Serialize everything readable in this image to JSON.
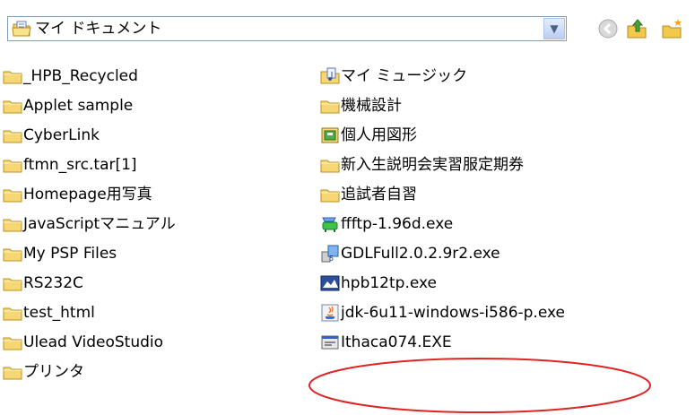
{
  "address": {
    "location": "マイ ドキュメント"
  },
  "items": [
    {
      "label": "_HPB_Recycled",
      "icon": "folder-icon"
    },
    {
      "label": "Applet sample",
      "icon": "folder-icon"
    },
    {
      "label": "CyberLink",
      "icon": "folder-icon"
    },
    {
      "label": "ftmn_src.tar[1]",
      "icon": "folder-icon"
    },
    {
      "label": "Homepage用写真",
      "icon": "folder-icon"
    },
    {
      "label": "JavaScriptマニュアル",
      "icon": "folder-icon"
    },
    {
      "label": "My PSP Files",
      "icon": "folder-icon"
    },
    {
      "label": "RS232C",
      "icon": "folder-icon"
    },
    {
      "label": "test_html",
      "icon": "folder-icon"
    },
    {
      "label": "Ulead VideoStudio",
      "icon": "folder-icon"
    },
    {
      "label": "プリンタ",
      "icon": "folder-icon"
    },
    {
      "label": "マイ ミュージック",
      "icon": "music-folder-icon"
    },
    {
      "label": "機械設計",
      "icon": "folder-icon"
    },
    {
      "label": "個人用図形",
      "icon": "shapes-folder-icon"
    },
    {
      "label": "新入生説明会実習服定期券",
      "icon": "folder-icon"
    },
    {
      "label": "追試者自習",
      "icon": "folder-icon"
    },
    {
      "label": "ffftp-1.96d.exe",
      "icon": "ftp-exe-icon"
    },
    {
      "label": "GDLFull2.0.2.9r2.exe",
      "icon": "installer-exe-icon"
    },
    {
      "label": "hpb12tp.exe",
      "icon": "hpb-exe-icon"
    },
    {
      "label": "jdk-6u11-windows-i586-p.exe",
      "icon": "java-exe-icon"
    },
    {
      "label": "Ithaca074.EXE",
      "icon": "generic-exe-icon"
    }
  ]
}
